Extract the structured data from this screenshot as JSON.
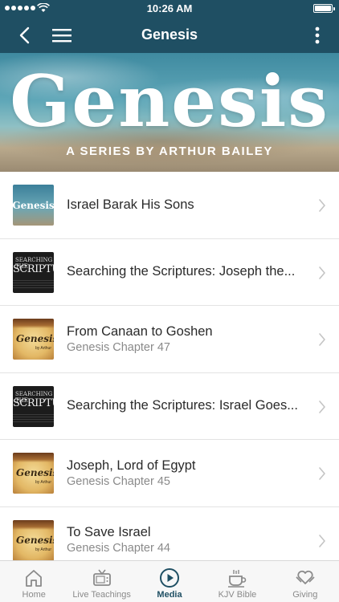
{
  "status_bar": {
    "time": "10:26 AM"
  },
  "nav": {
    "title": "Genesis"
  },
  "hero": {
    "title": "Genesis",
    "subtitle": "A SERIES BY ARTHUR BAILEY"
  },
  "items": [
    {
      "title": "Israel Barak His Sons",
      "subtitle": "",
      "thumb": "genesis-blue",
      "thumb_text": "Genesis"
    },
    {
      "title": "Searching the Scriptures: Joseph the...",
      "subtitle": "",
      "thumb": "scripture",
      "thumb_text": "SEARCHING THE",
      "thumb_text2": "SCRIPTURE"
    },
    {
      "title": "From Canaan to Goshen",
      "subtitle": "Genesis Chapter 47",
      "thumb": "parchment",
      "thumb_text": "Genesis",
      "thumb_text2": "by Arthur"
    },
    {
      "title": "Searching the Scriptures: Israel Goes...",
      "subtitle": "",
      "thumb": "scripture",
      "thumb_text": "SEARCHING THE",
      "thumb_text2": "SCRIPTURE"
    },
    {
      "title": "Joseph, Lord of Egypt",
      "subtitle": "Genesis Chapter 45",
      "thumb": "parchment",
      "thumb_text": "Genesis",
      "thumb_text2": "by Arthur"
    },
    {
      "title": "To Save Israel",
      "subtitle": "Genesis Chapter 44",
      "thumb": "parchment",
      "thumb_text": "Genesis",
      "thumb_text2": "by Arthur"
    }
  ],
  "tabs": [
    {
      "label": "Home",
      "icon": "home-icon",
      "active": false
    },
    {
      "label": "Live Teachings",
      "icon": "tv-icon",
      "active": false
    },
    {
      "label": "Media",
      "icon": "play-circle-icon",
      "active": true
    },
    {
      "label": "KJV Bible",
      "icon": "coffee-cup-icon",
      "active": false
    },
    {
      "label": "Giving",
      "icon": "heart-hand-icon",
      "active": false
    }
  ],
  "colors": {
    "primary": "#1f4f63",
    "inactive": "#8a8a8a",
    "divider": "#e3e3e3"
  }
}
